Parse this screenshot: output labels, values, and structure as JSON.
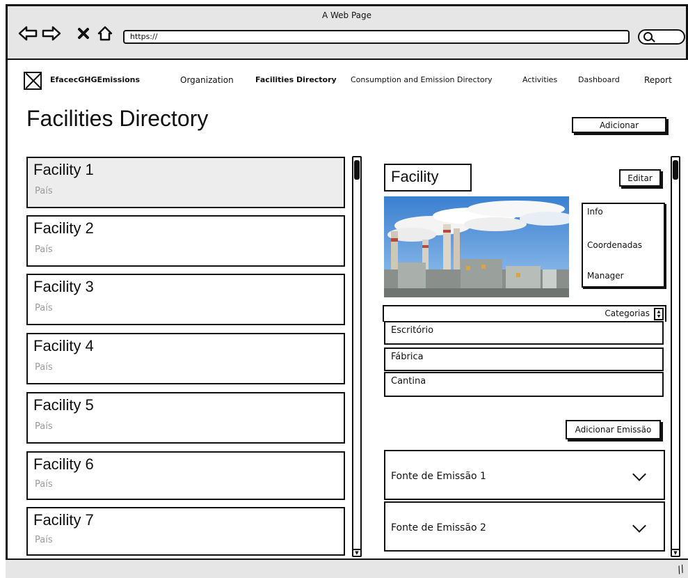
{
  "browser": {
    "window_title": "A Web Page",
    "url": "https://",
    "back_icon": "back-arrow-icon",
    "forward_icon": "forward-arrow-icon",
    "close_icon": "close-icon",
    "home_icon": "home-icon"
  },
  "header": {
    "brand": "EfacecGHGEmissions",
    "nav": [
      {
        "label": "Organization",
        "active": false
      },
      {
        "label": "Facilities Directory",
        "active": true
      },
      {
        "label": "Consumption and Emission Directory",
        "active": false
      },
      {
        "label": "Activities",
        "active": false
      },
      {
        "label": "Dashboard",
        "active": false
      },
      {
        "label": "Report",
        "active": false
      }
    ]
  },
  "page": {
    "title": "Facilities Directory",
    "add_label": "Adicionar"
  },
  "facilities": [
    {
      "name": "Facility 1",
      "subtitle": "País"
    },
    {
      "name": "Facility 2",
      "subtitle": "País"
    },
    {
      "name": "Facility 3",
      "subtitle": "País"
    },
    {
      "name": "Facility 4",
      "subtitle": "País"
    },
    {
      "name": "Facility 5",
      "subtitle": "País"
    },
    {
      "name": "Facility 6",
      "subtitle": "País"
    },
    {
      "name": "Facility 7",
      "subtitle": "País"
    }
  ],
  "detail": {
    "title": "Facility",
    "edit_label": "Editar",
    "info_items": [
      "Info",
      "Coordenadas",
      "Manager"
    ],
    "categories_label": "Categorias",
    "categories": [
      "Escritório",
      "Fábrica",
      "Cantina"
    ],
    "add_emission_label": "Adicionar Emissão",
    "emission_sources": [
      "Fonte de Emissão 1",
      "Fonte de Emissão 2"
    ]
  }
}
